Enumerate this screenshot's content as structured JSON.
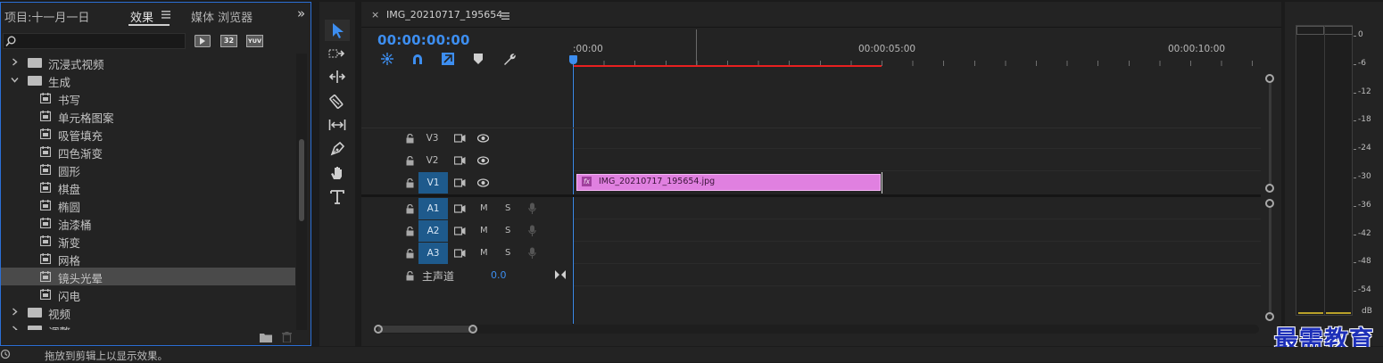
{
  "effects_panel": {
    "project_tab": "项目:十一月一日",
    "effects_tab": "效果",
    "media_browser_tab": "媒体 浏览器",
    "expand_glyph": "»",
    "filter_badges": [
      "32",
      "YUV"
    ],
    "tree": [
      {
        "type": "folder",
        "label": "沉浸式视频",
        "expanded": false
      },
      {
        "type": "folder",
        "label": "生成",
        "expanded": true
      },
      {
        "type": "effect",
        "label": "书写"
      },
      {
        "type": "effect",
        "label": "单元格图案"
      },
      {
        "type": "effect",
        "label": "吸管填充"
      },
      {
        "type": "effect",
        "label": "四色渐变"
      },
      {
        "type": "effect",
        "label": "圆形"
      },
      {
        "type": "effect",
        "label": "棋盘"
      },
      {
        "type": "effect",
        "label": "椭圆"
      },
      {
        "type": "effect",
        "label": "油漆桶"
      },
      {
        "type": "effect",
        "label": "渐变"
      },
      {
        "type": "effect",
        "label": "网格"
      },
      {
        "type": "effect",
        "label": "镜头光晕",
        "selected": true
      },
      {
        "type": "effect",
        "label": "闪电"
      },
      {
        "type": "folder",
        "label": "视频",
        "expanded": false
      },
      {
        "type": "folder",
        "label": "调整",
        "expanded": false
      }
    ]
  },
  "timeline": {
    "sequence_name": "IMG_20210717_195654",
    "timecode": "00:00:00:00",
    "ruler_labels": [
      ":00:00",
      "00:00:05:00",
      "00:00:10:00"
    ],
    "video_tracks": [
      {
        "label": "V3",
        "targeted": false
      },
      {
        "label": "V2",
        "targeted": false
      },
      {
        "label": "V1",
        "targeted": true
      }
    ],
    "audio_tracks": [
      {
        "label": "A1"
      },
      {
        "label": "A2"
      },
      {
        "label": "A3"
      }
    ],
    "mute_label": "M",
    "solo_label": "S",
    "master": {
      "label": "主声道",
      "value": "0.0"
    },
    "clip": {
      "name": "IMG_20210717_195654.jpg",
      "fx_label": "fx",
      "color": "#e080e0"
    }
  },
  "meter": {
    "ticks": [
      "0",
      "-6",
      "-12",
      "-18",
      "-24",
      "-30",
      "-36",
      "-42",
      "-48",
      "-54",
      "dB"
    ]
  },
  "status_bar": {
    "message": "拖放到剪辑上以显示效果。"
  },
  "watermark": "最需教育",
  "colors": {
    "accent": "#3d8ef0",
    "target_blue": "#1e5a8c",
    "clip": "#e080e0",
    "work_area": "#e82020"
  }
}
